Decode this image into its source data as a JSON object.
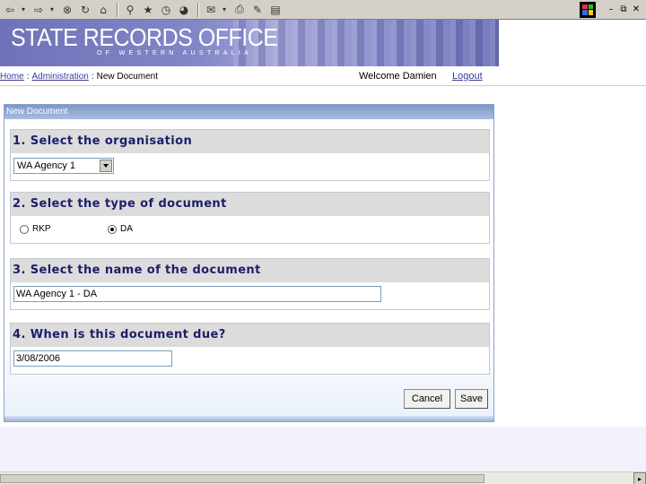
{
  "toolbar": {
    "icons": [
      "back-icon",
      "forward-icon",
      "stop-icon",
      "refresh-icon",
      "home-icon",
      "search-icon",
      "favorites-icon",
      "history-icon",
      "media-icon",
      "mail-icon",
      "print-icon",
      "edit-icon",
      "discuss-icon"
    ]
  },
  "window_controls": {
    "minimize": "–",
    "restore": "⧉",
    "close": "✕"
  },
  "banner": {
    "title": "STATE RECORDS OFFICE",
    "subtitle": "OF WESTERN AUSTRALIA"
  },
  "breadcrumb": {
    "home": "Home",
    "separator": ":",
    "administration": "Administration",
    "current": "New Document"
  },
  "user": {
    "welcome": "Welcome Damien",
    "logout": "Logout"
  },
  "panel": {
    "title": "New Document"
  },
  "step1": {
    "heading": "1. Select the organisation",
    "selected": "WA Agency 1"
  },
  "step2": {
    "heading": "2. Select the type of document",
    "options": [
      {
        "label": "RKP",
        "checked": false
      },
      {
        "label": "DA",
        "checked": true
      }
    ]
  },
  "step3": {
    "heading": "3. Select the name of the document",
    "value": "WA Agency 1 - DA"
  },
  "step4": {
    "heading": "4. When is this document due?",
    "value": "3/08/2006"
  },
  "buttons": {
    "cancel": "Cancel",
    "save": "Save"
  },
  "colors": {
    "heading_text": "#1d1d6b",
    "link": "#3a3a9a",
    "banner": "#7a7dc0"
  }
}
